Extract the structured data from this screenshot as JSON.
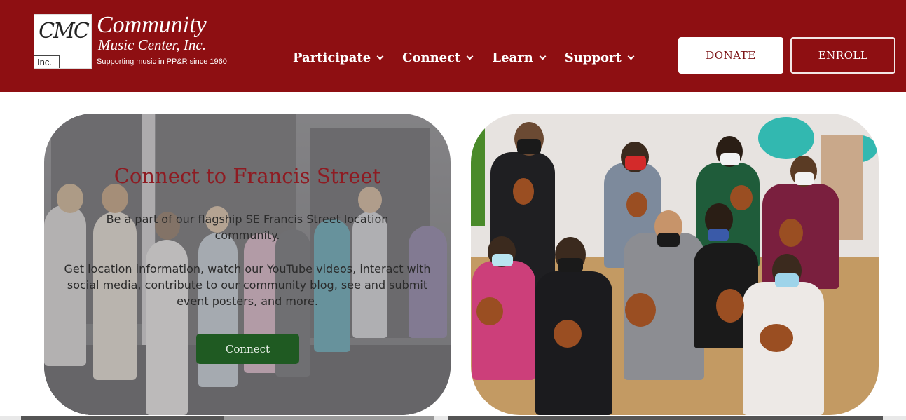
{
  "header": {
    "logo": {
      "mark": "CMC",
      "inc": "Inc."
    },
    "org_name": "Community",
    "org_subtitle": "Music Center, Inc.",
    "tagline": "Supporting music in PP&R since 1960",
    "nav": [
      {
        "label": "Participate"
      },
      {
        "label": "Connect"
      },
      {
        "label": "Learn"
      },
      {
        "label": "Support"
      }
    ],
    "donate_label": "DONATE",
    "enroll_label": "ENROLL"
  },
  "card_left": {
    "title": "Connect to Francis Street",
    "description_1": "Be a part of our flagship SE Francis Street location community.",
    "description_2": "Get location information, watch our YouTube videos, interact with social media, contribute to our community blog, see and submit event posters, and more.",
    "button_label": "Connect"
  },
  "colors": {
    "header_bg": "#8e0f12",
    "title_color": "#8e1b22",
    "button_green": "#1f5a22"
  }
}
